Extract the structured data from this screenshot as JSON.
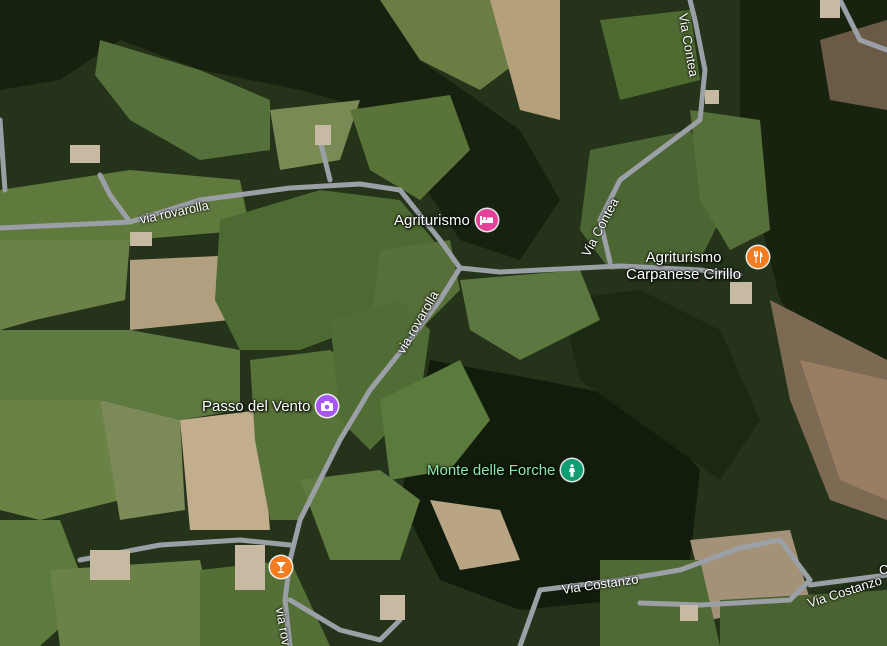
{
  "colors": {
    "forest": "#1c2a14",
    "field": "#4f6a33",
    "field_light": "#6d7f45",
    "bare": "#b9a483",
    "road": "#9aa0a6",
    "lodging_pin": "#e6409b",
    "camera_pin": "#a855f7",
    "park_pin": "#0f9d72",
    "food_pin": "#f47c20"
  },
  "places": [
    {
      "name": "Agriturismo",
      "icon": "bed-icon"
    },
    {
      "name": "Agriturismo\nCarpanese Cirillo",
      "icon": "restaurant-icon"
    },
    {
      "name": "Passo del Vento",
      "icon": "camera-icon"
    },
    {
      "name": "Monte delle Forche",
      "icon": "hiker-icon"
    },
    {
      "name": "",
      "icon": "bar-icon"
    }
  ],
  "roads": [
    "via rovarolla",
    "via rovarolla",
    "Via Contea",
    "Via Contea",
    "Via Costanzo",
    "Via Costanzo",
    "via rov"
  ],
  "edge_text": "C"
}
